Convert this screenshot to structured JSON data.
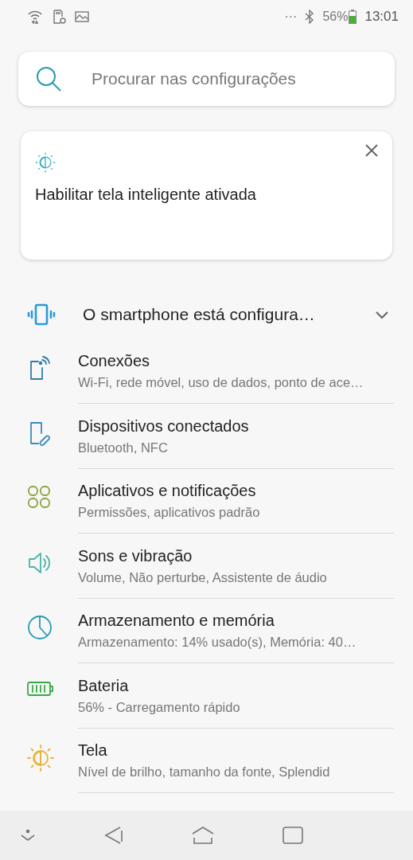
{
  "status_bar": {
    "more": "···",
    "battery": "56%",
    "time": "13:01"
  },
  "search": {
    "placeholder": "Procurar nas configurações"
  },
  "suggestion": {
    "text": "Habilitar tela inteligente ativada"
  },
  "summary": {
    "text": "O smartphone está configura…",
    "expanded": false
  },
  "items": [
    {
      "kind": "connections",
      "title": "Conexões",
      "subtitle": "Wi-Fi, rede móvel, uso de dados, ponto de ace…"
    },
    {
      "kind": "devices",
      "title": "Dispositivos conectados",
      "subtitle": "Bluetooth, NFC"
    },
    {
      "kind": "apps",
      "title": "Aplicativos e notificações",
      "subtitle": "Permissões, aplicativos padrão"
    },
    {
      "kind": "sound",
      "title": "Sons e vibração",
      "subtitle": "Volume, Não perturbe, Assistente de áudio"
    },
    {
      "kind": "storage",
      "title": "Armazenamento e memória",
      "subtitle": "Armazenamento: 14% usado(s), Memória: 40…"
    },
    {
      "kind": "battery",
      "title": "Bateria",
      "subtitle": "56% - Carregamento rápido"
    },
    {
      "kind": "display",
      "title": "Tela",
      "subtitle": "Nível de brilho, tamanho da fonte, Splendid"
    }
  ]
}
